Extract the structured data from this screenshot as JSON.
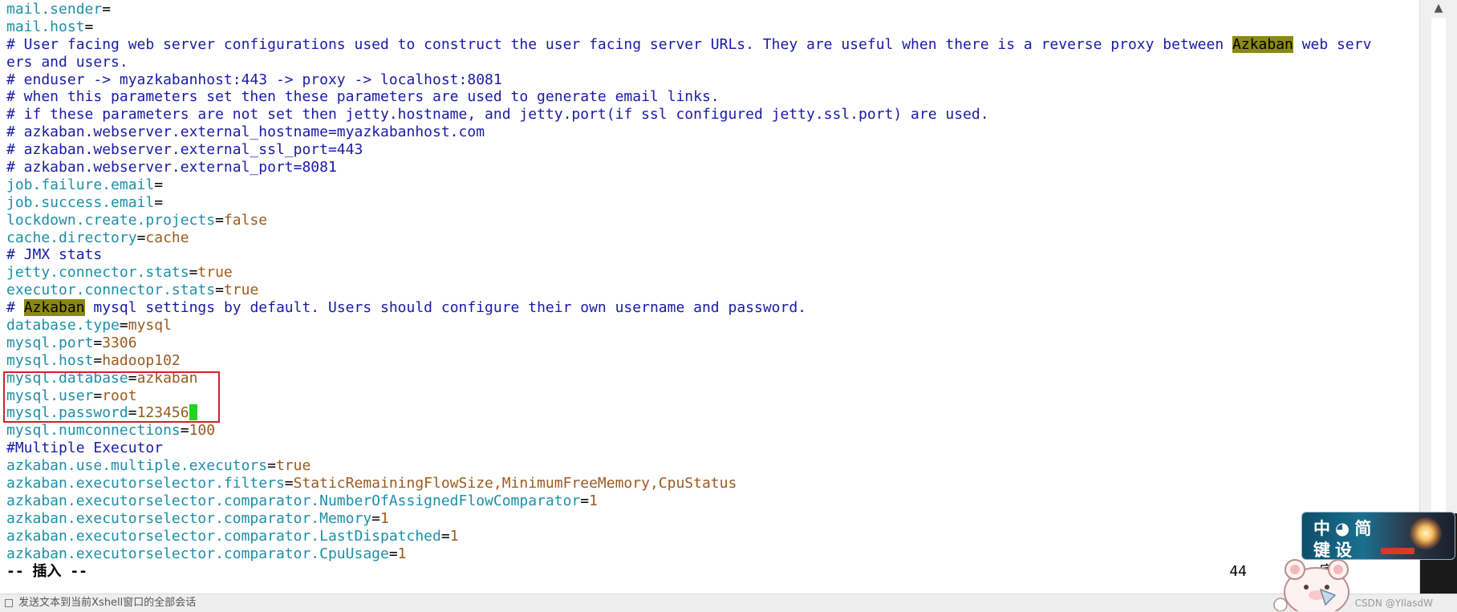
{
  "editor": {
    "lines": [
      {
        "type": "kv",
        "key": "mail.sender",
        "value": ""
      },
      {
        "type": "kv",
        "key": "mail.host",
        "value": ""
      },
      {
        "type": "comment",
        "pre": "# User facing web server configurations used to construct the user facing server URLs. They are useful when there is a reverse proxy between ",
        "hl": "Azkaban",
        "post": " web serv"
      },
      {
        "type": "comment",
        "text": "ers and users."
      },
      {
        "type": "comment",
        "text": "# enduser -> myazkabanhost:443 -> proxy -> localhost:8081"
      },
      {
        "type": "comment",
        "text": "# when this parameters set then these parameters are used to generate email links."
      },
      {
        "type": "comment",
        "text": "# if these parameters are not set then jetty.hostname, and jetty.port(if ssl configured jetty.ssl.port) are used."
      },
      {
        "type": "comment",
        "text": "# azkaban.webserver.external_hostname=myazkabanhost.com"
      },
      {
        "type": "comment",
        "text": "# azkaban.webserver.external_ssl_port=443"
      },
      {
        "type": "comment",
        "text": "# azkaban.webserver.external_port=8081"
      },
      {
        "type": "kv",
        "key": "job.failure.email",
        "value": ""
      },
      {
        "type": "kv",
        "key": "job.success.email",
        "value": ""
      },
      {
        "type": "kv",
        "key": "lockdown.create.projects",
        "value": "false"
      },
      {
        "type": "kv",
        "key": "cache.directory",
        "value": "cache"
      },
      {
        "type": "comment",
        "text": "# JMX stats"
      },
      {
        "type": "kv",
        "key": "jetty.connector.stats",
        "value": "true"
      },
      {
        "type": "kv",
        "key": "executor.connector.stats",
        "value": "true"
      },
      {
        "type": "comment",
        "pre": "# ",
        "hl": "Azkaban",
        "post": " mysql settings by default. Users should configure their own username and password."
      },
      {
        "type": "kv",
        "key": "database.type",
        "value": "mysql"
      },
      {
        "type": "kv",
        "key": "mysql.port",
        "value": "3306"
      },
      {
        "type": "kv",
        "key": "mysql.host",
        "value": "hadoop102"
      },
      {
        "type": "kv",
        "key": "mysql.database",
        "value": "azkaban"
      },
      {
        "type": "kv",
        "key": "mysql.user",
        "value": "root"
      },
      {
        "type": "kv",
        "key": "mysql.password",
        "value": "123456",
        "cursor": true
      },
      {
        "type": "kv",
        "key": "mysql.numconnections",
        "value": "100"
      },
      {
        "type": "comment",
        "text": "#Multiple Executor"
      },
      {
        "type": "kv",
        "key": "azkaban.use.multiple.executors",
        "value": "true"
      },
      {
        "type": "kv",
        "key": "azkaban.executorselector.filters",
        "value": "StaticRemainingFlowSize,MinimumFreeMemory,CpuStatus"
      },
      {
        "type": "kv",
        "key": "azkaban.executorselector.comparator.NumberOfAssignedFlowComparator",
        "value": "1"
      },
      {
        "type": "kv",
        "key": "azkaban.executorselector.comparator.Memory",
        "value": "1"
      },
      {
        "type": "kv",
        "key": "azkaban.executorselector.comparator.LastDispatched",
        "value": "1"
      },
      {
        "type": "kv",
        "key": "azkaban.executorselector.comparator.CpuUsage",
        "value": "1"
      }
    ],
    "mode": "-- 插入 --",
    "ruler_line": "44",
    "ruler_extra": "",
    "ruler_bottom": "底"
  },
  "statusbar": {
    "text": "发送文本到当前Xshell窗口的全部会话",
    "watermark": "CSDN @YIlasdW"
  },
  "ime": {
    "row1": "中◕简",
    "row2": "键设"
  },
  "colors": {
    "key": "#1d8fa7",
    "value": "#9a5a1e",
    "comment": "#1a1aa6",
    "search_highlight": "#8a8a10",
    "cursor": "#22d322",
    "annotation_box": "#d0222a"
  },
  "icons": [
    "scroll-up-arrow-icon",
    "status-icon",
    "mascot-icon",
    "ime-spark-icon"
  ]
}
